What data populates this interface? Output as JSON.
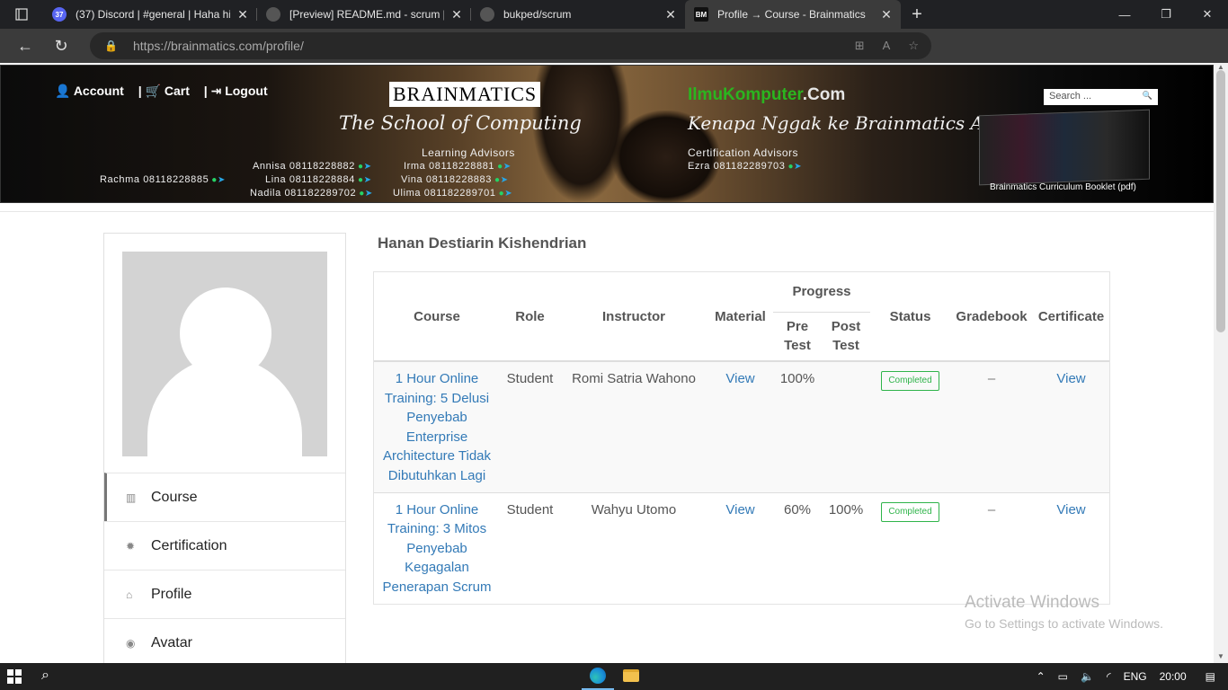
{
  "browser": {
    "tabs": [
      {
        "title": "(37) Discord | #general | Haha hi",
        "badge": "37",
        "color": "#5865f2"
      },
      {
        "title": "[Preview] README.md - scrum [C",
        "color": "#555555"
      },
      {
        "title": "bukped/scrum",
        "color": "#555555"
      },
      {
        "title": "Profile → Course - Brainmatics",
        "fav": "BM",
        "color": "#111111"
      }
    ],
    "url_host": "https://brainmatics.com",
    "url_path": "/profile/"
  },
  "banner": {
    "account": "Account",
    "cart": "Cart",
    "logout": "Logout",
    "brand": "BRAINMATICS",
    "tagline": "The School of Computing",
    "learning_advisors": "Learning Advisors",
    "ilmu_green": "IlmuKomputer",
    "ilmu_dotcom": ".Com",
    "tagline2": "Kenapa Nggak ke Brainmatics Aja?",
    "certification_advisors": "Certification Advisors",
    "contacts": {
      "rachma": "Rachma  08118228885",
      "annisa": "Annisa  08118228882",
      "irma": "Irma  08118228881",
      "lina": "Lina  08118228884",
      "vina": "Vina  08118228883",
      "nadila": "Nadila  081182289702",
      "ulima": "Ulima  081182289701",
      "ezra": "Ezra  081182289703"
    },
    "search_placeholder": "Search ...",
    "booklet_caption": "Brainmatics Curriculum Booklet (pdf)"
  },
  "sidebar": {
    "items": [
      {
        "label": "Course",
        "icon": "book-icon"
      },
      {
        "label": "Certification",
        "icon": "certificate-icon"
      },
      {
        "label": "Profile",
        "icon": "home-icon"
      },
      {
        "label": "Avatar",
        "icon": "user-circle-icon"
      }
    ]
  },
  "profile_name": "Hanan Destiarin Kishendrian",
  "table": {
    "headers": {
      "course": "Course",
      "role": "Role",
      "instructor": "Instructor",
      "material": "Material",
      "progress": "Progress",
      "pre_test": "Pre Test",
      "post_test": "Post Test",
      "status": "Status",
      "gradebook": "Gradebook",
      "certificate": "Certificate"
    },
    "rows": [
      {
        "course": "1 Hour Online Training: 5 Delusi Penyebab Enterprise Architecture Tidak Dibutuhkan Lagi",
        "role": "Student",
        "instructor": "Romi Satria Wahono",
        "material": "View",
        "pre_test": "100%",
        "post_test": "",
        "status": "Completed",
        "gradebook": "–",
        "certificate": "View"
      },
      {
        "course": "1 Hour Online Training: 3 Mitos Penyebab Kegagalan Penerapan Scrum",
        "role": "Student",
        "instructor": "Wahyu Utomo",
        "material": "View",
        "pre_test": "60%",
        "post_test": "100%",
        "status": "Completed",
        "gradebook": "–",
        "certificate": "View"
      }
    ]
  },
  "watermark": {
    "line1": "Activate Windows",
    "line2": "Go to Settings to activate Windows."
  },
  "taskbar": {
    "language": "ENG",
    "time": "20:00"
  }
}
